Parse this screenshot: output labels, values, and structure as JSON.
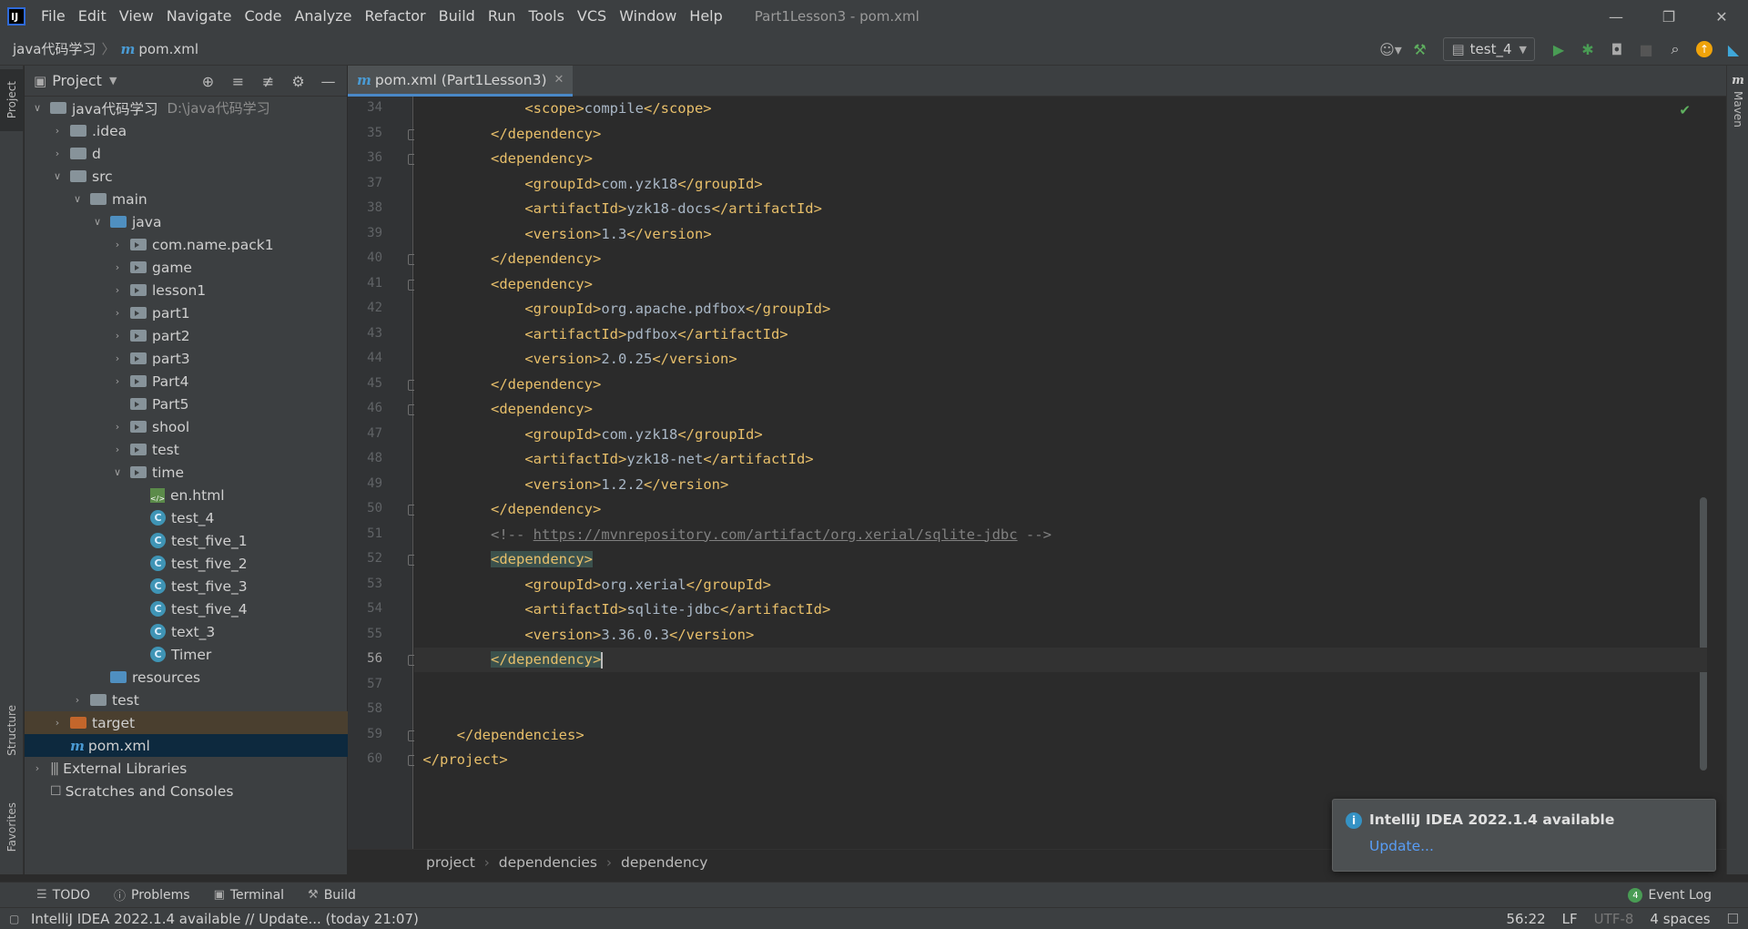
{
  "menubar": {
    "items": [
      "File",
      "Edit",
      "View",
      "Navigate",
      "Code",
      "Analyze",
      "Refactor",
      "Build",
      "Run",
      "Tools",
      "VCS",
      "Window",
      "Help"
    ],
    "window_title": "Part1Lesson3 - pom.xml"
  },
  "navbar": {
    "project_crumb": "java代码学习",
    "file_crumb": "pom.xml",
    "run_config": "test_4"
  },
  "project_panel": {
    "title": "Project",
    "tree": [
      {
        "label": "java代码学习",
        "sub": "D:\\java代码学习"
      },
      {
        "label": ".idea"
      },
      {
        "label": "d"
      },
      {
        "label": "src"
      },
      {
        "label": "main"
      },
      {
        "label": "java"
      },
      {
        "label": "com.name.pack1"
      },
      {
        "label": "game"
      },
      {
        "label": "lesson1"
      },
      {
        "label": "part1"
      },
      {
        "label": "part2"
      },
      {
        "label": "part3"
      },
      {
        "label": "Part4"
      },
      {
        "label": "Part5"
      },
      {
        "label": "shool"
      },
      {
        "label": "test"
      },
      {
        "label": "time"
      },
      {
        "label": "en.html"
      },
      {
        "label": "test_4"
      },
      {
        "label": "test_five_1"
      },
      {
        "label": "test_five_2"
      },
      {
        "label": "test_five_3"
      },
      {
        "label": "test_five_4"
      },
      {
        "label": "text_3"
      },
      {
        "label": "Timer"
      },
      {
        "label": "resources"
      },
      {
        "label": "test"
      },
      {
        "label": "target"
      },
      {
        "label": "pom.xml"
      },
      {
        "label": "External Libraries"
      },
      {
        "label": "Scratches and Consoles"
      }
    ]
  },
  "left_strip": {
    "project": "Project",
    "structure": "Structure",
    "favorites": "Favorites"
  },
  "right_strip": {
    "maven": "Maven"
  },
  "editor": {
    "tab_label": "pom.xml (Part1Lesson3)",
    "line_numbers": [
      "34",
      "35",
      "36",
      "37",
      "38",
      "39",
      "40",
      "41",
      "42",
      "43",
      "44",
      "45",
      "46",
      "47",
      "48",
      "49",
      "50",
      "51",
      "52",
      "53",
      "54",
      "55",
      "56",
      "57",
      "58",
      "59",
      "60"
    ],
    "lines": [
      {
        "i": "            ",
        "o": "<scope>",
        "t": "compile",
        "c": "</scope>"
      },
      {
        "i": "        ",
        "o": "</dependency>"
      },
      {
        "i": "        ",
        "o": "<dependency>"
      },
      {
        "i": "            ",
        "o": "<groupId>",
        "t": "com.yzk18",
        "c": "</groupId>"
      },
      {
        "i": "            ",
        "o": "<artifactId>",
        "t": "yzk18-docs",
        "c": "</artifactId>"
      },
      {
        "i": "            ",
        "o": "<version>",
        "t": "1.3",
        "c": "</version>"
      },
      {
        "i": "        ",
        "o": "</dependency>"
      },
      {
        "i": "        ",
        "o": "<dependency>"
      },
      {
        "i": "            ",
        "o": "<groupId>",
        "t": "org.apache.pdfbox",
        "c": "</groupId>"
      },
      {
        "i": "            ",
        "o": "<artifactId>",
        "t": "pdfbox",
        "c": "</artifactId>"
      },
      {
        "i": "            ",
        "o": "<version>",
        "t": "2.0.25",
        "c": "</version>"
      },
      {
        "i": "        ",
        "o": "</dependency>"
      },
      {
        "i": "        ",
        "o": "<dependency>"
      },
      {
        "i": "            ",
        "o": "<groupId>",
        "t": "com.yzk18",
        "c": "</groupId>"
      },
      {
        "i": "            ",
        "o": "<artifactId>",
        "t": "yzk18-net",
        "c": "</artifactId>"
      },
      {
        "i": "            ",
        "o": "<version>",
        "t": "1.2.2",
        "c": "</version>"
      },
      {
        "i": "        ",
        "o": "</dependency>"
      },
      {
        "i": "        ",
        "cm1": "<!-- ",
        "url": "https://mvnrepository.com/artifact/org.xerial/sqlite-jdbc",
        "cm2": " -->"
      },
      {
        "i": "        ",
        "o": "<dependency>",
        "hl": true
      },
      {
        "i": "            ",
        "o": "<groupId>",
        "t": "org.xerial",
        "c": "</groupId>"
      },
      {
        "i": "            ",
        "o": "<artifactId>",
        "t": "sqlite-jdbc",
        "c": "</artifactId>"
      },
      {
        "i": "            ",
        "o": "<version>",
        "t": "3.36.0.3",
        "c": "</version>"
      },
      {
        "i": "        ",
        "o": "</dependency>",
        "hl": true,
        "caret": true
      },
      {
        "i": ""
      },
      {
        "i": ""
      },
      {
        "i": "    ",
        "o": "</dependencies>"
      },
      {
        "i": "",
        "o": "</project>"
      }
    ],
    "current_line": "56",
    "breadcrumb": [
      "project",
      "dependencies",
      "dependency"
    ]
  },
  "bottom_tabs": {
    "todo": "TODO",
    "problems": "Problems",
    "terminal": "Terminal",
    "build": "Build",
    "event_log": "Event Log",
    "event_count": "4"
  },
  "statusbar": {
    "message": "IntelliJ IDEA 2022.1.4 available // Update... (today 21:07)",
    "position": "56:22",
    "line_sep": "LF",
    "encoding": "UTF-8",
    "indent": "4 spaces"
  },
  "notification": {
    "title": "IntelliJ IDEA 2022.1.4 available",
    "link": "Update..."
  },
  "colors": {
    "tag": "#e8bf6a",
    "text": "#a9b7c6",
    "comment": "#808080",
    "accent": "#4a88c7",
    "run": "#499c54"
  }
}
